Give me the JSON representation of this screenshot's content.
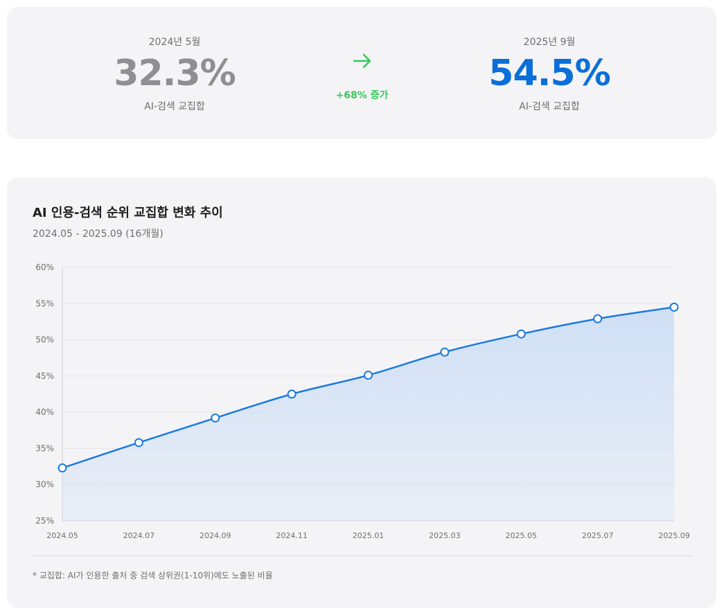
{
  "summary": {
    "before": {
      "period": "2024년 5월",
      "value": "32.3%",
      "label": "AI-검색 교집합"
    },
    "change": {
      "arrow_icon": "arrow-right-icon",
      "text": "+68% 증가",
      "color": "#34c759"
    },
    "after": {
      "period": "2025년 9월",
      "value": "54.5%",
      "label": "AI-검색 교집합"
    }
  },
  "chart_data": {
    "type": "area",
    "title": "AI 인용-검색 순위 교집합 변화 추이",
    "subtitle": "2024.05 - 2025.09 (16개월)",
    "x": [
      "2024.05",
      "2024.07",
      "2024.09",
      "2024.11",
      "2025.01",
      "2025.03",
      "2025.05",
      "2025.07",
      "2025.09"
    ],
    "series": [
      {
        "values": [
          32.3,
          35.8,
          39.2,
          42.5,
          45.1,
          48.3,
          50.8,
          52.9,
          54.5
        ]
      }
    ],
    "y_ticks": [
      "25%",
      "30%",
      "35%",
      "40%",
      "45%",
      "50%",
      "55%",
      "60%"
    ],
    "ylim": [
      25,
      60
    ],
    "grid": true,
    "line_color": "#1a7ae0",
    "fill_color": "#c9dcf5"
  },
  "footnote": "* 교집합: AI가 인용한 출처 중 검색 상위권(1-10위)에도 노출된 비율"
}
